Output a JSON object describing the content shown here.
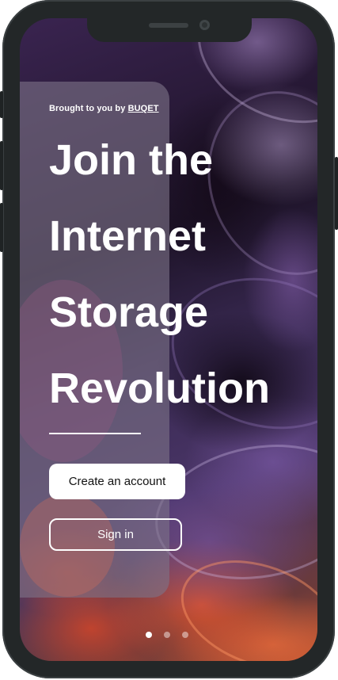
{
  "promo": {
    "brought_by_prefix": "Brought to you by ",
    "brand_name": "BUQET"
  },
  "headline": {
    "line1": "Join the",
    "line2": "Internet",
    "line3": "Storage",
    "line4": "Revolution"
  },
  "actions": {
    "create_account_label": "Create an account",
    "sign_in_label": "Sign in"
  },
  "pagination": {
    "total_pages": 3,
    "active_page": 1
  },
  "colors": {
    "text_primary": "#ffffff",
    "button_fill": "#ffffff",
    "button_text": "#111111",
    "frame": "#232728",
    "background_accent_purple": "#4a3567",
    "background_accent_orange": "#e0552d"
  }
}
